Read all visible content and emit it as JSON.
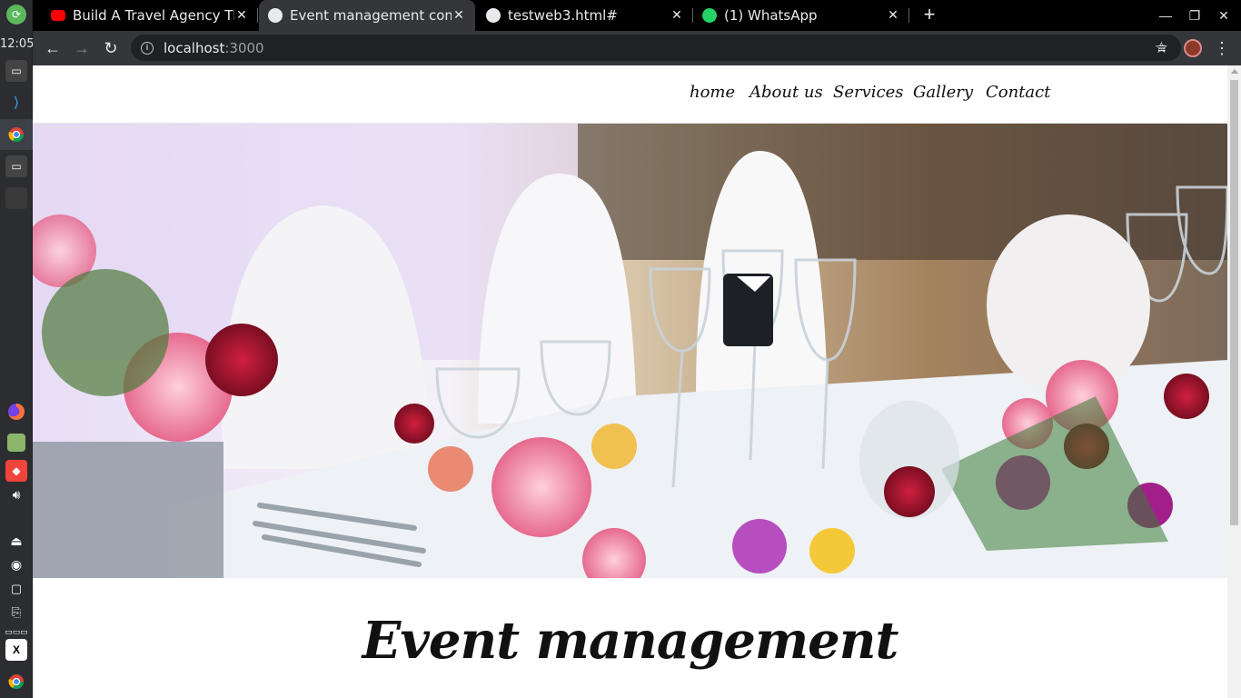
{
  "os": {
    "clock": "12:05"
  },
  "tabs": [
    {
      "title": "Build A Travel Agency The",
      "favicon": "youtube-icon",
      "color": "#ff0000"
    },
    {
      "title": "Event management comm",
      "favicon": "globe-icon",
      "color": "#e8eaed"
    },
    {
      "title": "testweb3.html#",
      "favicon": "globe-icon",
      "color": "#e8eaed"
    },
    {
      "title": "(1) WhatsApp",
      "favicon": "whatsapp-icon",
      "color": "#25d366"
    }
  ],
  "address": {
    "host": "localhost",
    "port": ":3000"
  },
  "site": {
    "nav": [
      "home",
      "About us",
      "Services",
      "Gallery",
      "Contact"
    ],
    "headline": "Event management"
  }
}
